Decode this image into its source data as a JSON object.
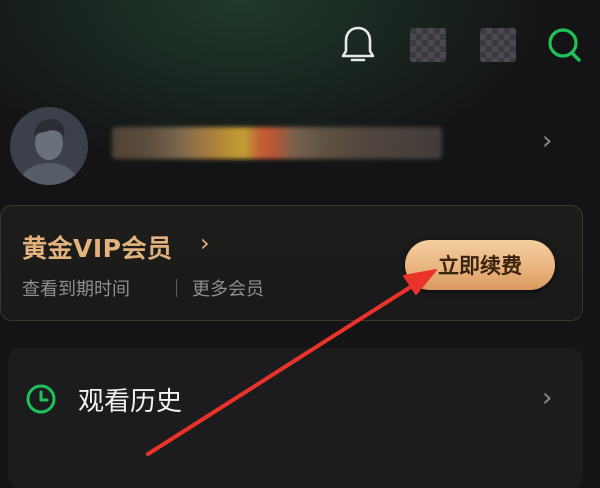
{
  "vip": {
    "title": "黄金VIP会员",
    "expiry_link": "查看到期时间",
    "more_link": "更多会员",
    "renew_button": "立即续费"
  },
  "menu": {
    "history_label": "观看历史"
  },
  "icons": {
    "notification": "bell-icon",
    "search": "search-icon",
    "history": "clock-icon",
    "chevron": "chevron-right-icon"
  },
  "colors": {
    "background": "#141416",
    "vip_gold": "#e2b37c",
    "accent_green": "#1fc25a",
    "annotation_red": "#e8322a"
  }
}
